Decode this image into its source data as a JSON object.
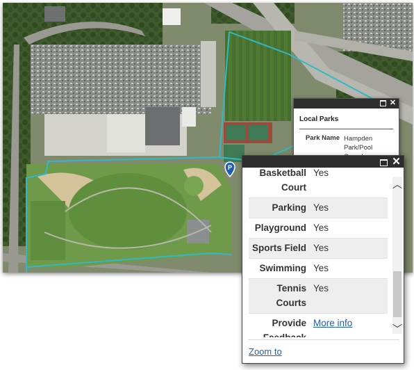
{
  "map": {
    "layer_outline_color": "#32b8c6",
    "parking_marker_label": "P"
  },
  "popup_back": {
    "heading": "Local Parks",
    "fields": [
      {
        "name": "Park Name",
        "value_lines": [
          "Hampden",
          "Park/Pool",
          "Complex"
        ]
      }
    ]
  },
  "popup_front": {
    "fields": [
      {
        "name": "Basketball Court",
        "value": "Yes"
      },
      {
        "name": "Parking",
        "value": "Yes"
      },
      {
        "name": "Playground",
        "value": "Yes"
      },
      {
        "name": "Sports Field",
        "value": "Yes"
      },
      {
        "name": "Swimming",
        "value": "Yes"
      },
      {
        "name": "Tennis Courts",
        "value": "Yes"
      },
      {
        "name": "Provide Feedback",
        "link_text": "More info"
      }
    ],
    "zoom_label": "Zoom to"
  },
  "icons": {
    "maximize": "maximize-icon",
    "close": "close-icon",
    "scroll_up": "chevron-up-icon",
    "scroll_down": "chevron-down-icon",
    "parking_marker": "parking-marker-icon"
  },
  "glyphs": {
    "close": "✕",
    "chevron_up": "︿",
    "chevron_down": "﹀",
    "close_heavy": "✕"
  }
}
